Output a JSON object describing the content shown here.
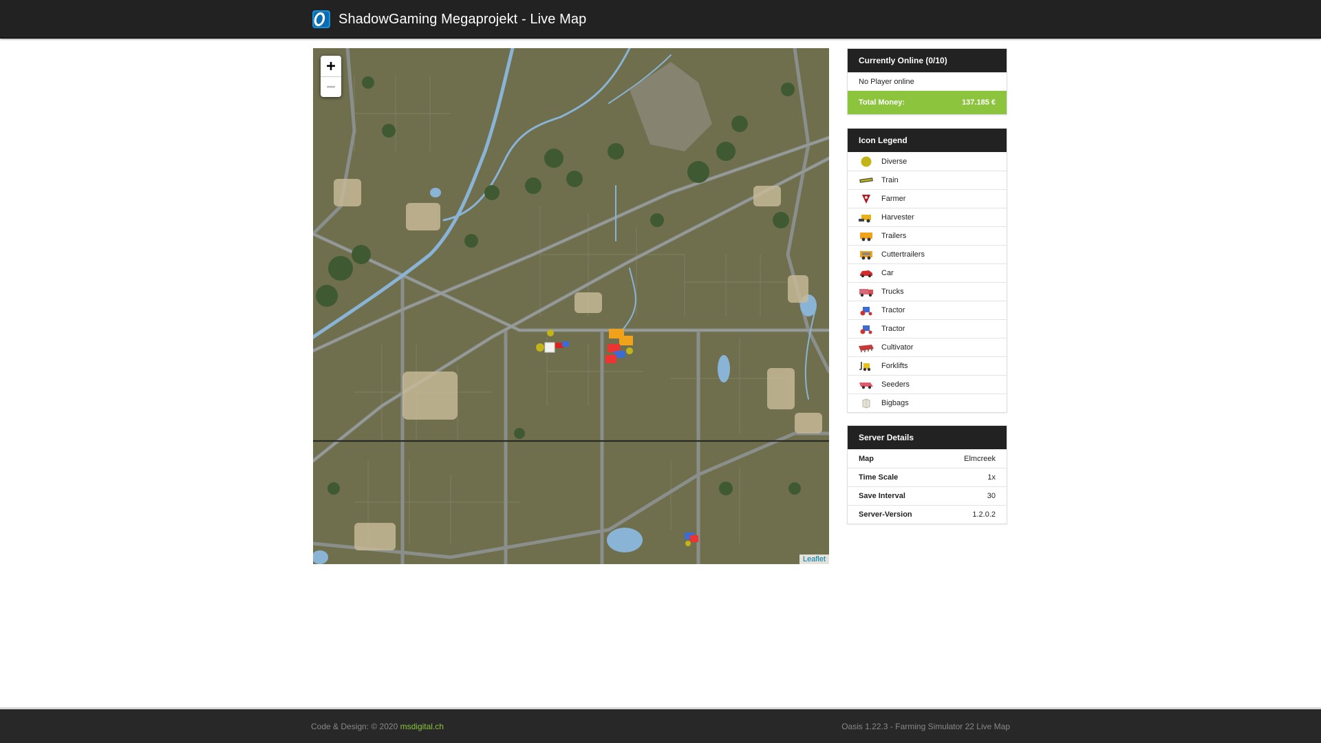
{
  "header": {
    "title": "ShadowGaming Megaprojekt - Live Map",
    "logo_icon": "oasis-logo-icon"
  },
  "map": {
    "zoom_in_label": "+",
    "zoom_out_label": "−",
    "attribution": "Leaflet"
  },
  "online": {
    "title": "Currently Online (0/10)",
    "status": "No Player online",
    "money_label": "Total Money:",
    "money_value": "137.185 €"
  },
  "legend": {
    "title": "Icon Legend",
    "items": [
      {
        "label": "Diverse",
        "icon": "diverse-icon"
      },
      {
        "label": "Train",
        "icon": "train-icon"
      },
      {
        "label": "Farmer",
        "icon": "farmer-icon"
      },
      {
        "label": "Harvester",
        "icon": "harvester-icon"
      },
      {
        "label": "Trailers",
        "icon": "trailer-icon"
      },
      {
        "label": "Cuttertrailers",
        "icon": "cuttertrailer-icon"
      },
      {
        "label": "Car",
        "icon": "car-icon"
      },
      {
        "label": "Trucks",
        "icon": "truck-icon"
      },
      {
        "label": "Tractor",
        "icon": "tractor-icon"
      },
      {
        "label": "Tractor",
        "icon": "tractor-icon"
      },
      {
        "label": "Cultivator",
        "icon": "cultivator-icon"
      },
      {
        "label": "Forklifts",
        "icon": "forklift-icon"
      },
      {
        "label": "Seeders",
        "icon": "seeder-icon"
      },
      {
        "label": "Bigbags",
        "icon": "bigbag-icon"
      }
    ]
  },
  "server": {
    "title": "Server Details",
    "rows": [
      {
        "key": "Map",
        "value": "Elmcreek"
      },
      {
        "key": "Time Scale",
        "value": "1x"
      },
      {
        "key": "Save Interval",
        "value": "30"
      },
      {
        "key": "Server-Version",
        "value": "1.2.0.2"
      }
    ]
  },
  "footer": {
    "left_prefix": "Code & Design: © 2020",
    "left_link": "msdigital.ch",
    "right": "Oasis 1.22.3 - Farming Simulator 22 Live Map"
  },
  "colors": {
    "header_bg": "#222222",
    "accent_green": "#8cc43d",
    "map_ground": "#6f6f4e",
    "map_road": "#8a8f8c",
    "map_water": "#8ab4d6"
  }
}
